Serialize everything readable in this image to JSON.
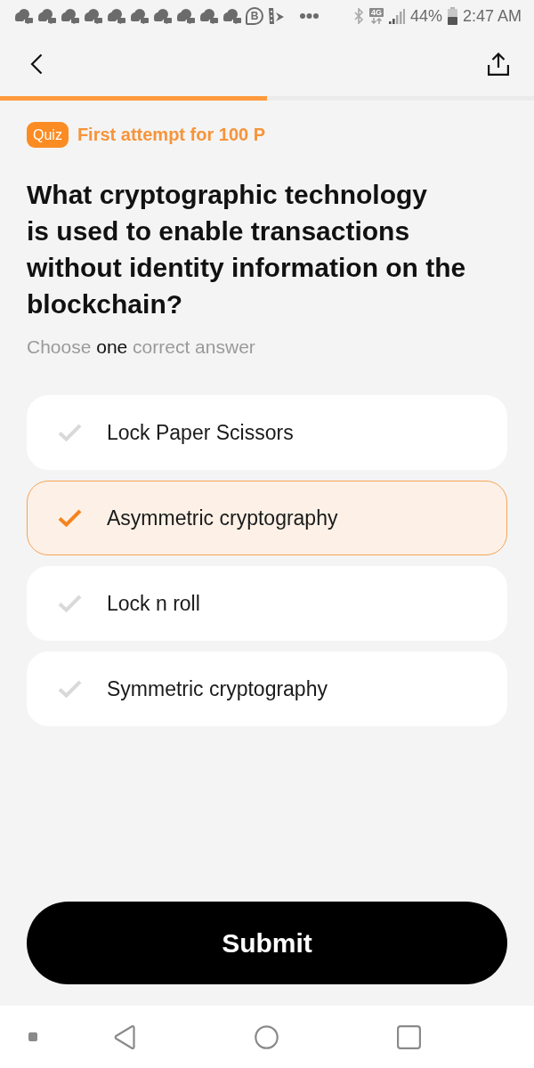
{
  "status_bar": {
    "notifications": [
      {
        "kind": "cloud-chat"
      },
      {
        "kind": "cloud-chat"
      },
      {
        "kind": "cloud-chat"
      },
      {
        "kind": "cloud-chat"
      },
      {
        "kind": "cloud-chat"
      },
      {
        "kind": "cloud-chat"
      },
      {
        "kind": "cloud-chat"
      },
      {
        "kind": "cloud-chat"
      },
      {
        "kind": "cloud-chat"
      },
      {
        "kind": "cloud-chat"
      },
      {
        "kind": "letter-bubble",
        "letter": "B"
      },
      {
        "kind": "striped-arrow"
      }
    ],
    "network_type": "4G",
    "battery": "44%",
    "time": "2:47 AM"
  },
  "progress": {
    "level": 0.5
  },
  "quiz": {
    "badge": "Quiz",
    "reward": "First attempt for 100 P",
    "question": "What cryptographic technology\nis used to enable transactions without identity information on the blockchain?",
    "hint": [
      {
        "text": "Choose ",
        "highlight": false
      },
      {
        "text": "one",
        "highlight": true
      },
      {
        "text": " correct answer",
        "highlight": false
      }
    ]
  },
  "options": [
    {
      "label": "Lock Paper Scissors",
      "selected": false
    },
    {
      "label": "Asymmetric cryptography",
      "selected": true
    },
    {
      "label": "Lock n roll",
      "selected": false
    },
    {
      "label": "Symmetric cryptography",
      "selected": false
    }
  ],
  "submit": "Submit"
}
